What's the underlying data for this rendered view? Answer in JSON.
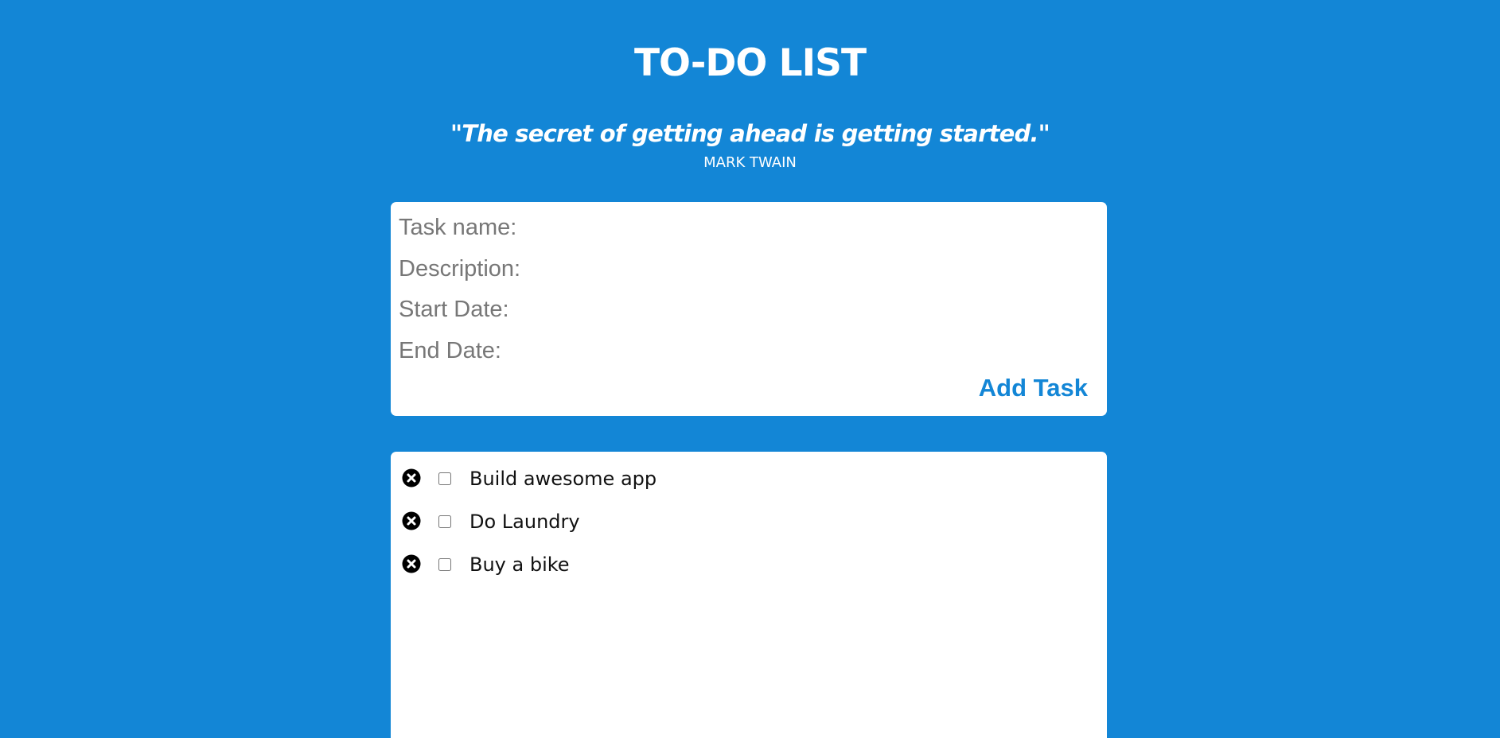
{
  "header": {
    "title": "TO-DO LIST",
    "quote": "\"The secret of getting ahead is getting started.\"",
    "author": "MARK TWAIN"
  },
  "form": {
    "task_name_placeholder": "Task name:",
    "description_placeholder": "Description:",
    "start_date_placeholder": "Start Date:",
    "end_date_placeholder": "End Date:",
    "add_button_label": "Add Task"
  },
  "tasks": [
    {
      "label": "Build awesome app",
      "checked": false,
      "delete_icon": "close-circle-icon"
    },
    {
      "label": "Do Laundry",
      "checked": false,
      "delete_icon": "close-circle-icon"
    },
    {
      "label": "Buy a bike",
      "checked": false,
      "delete_icon": "close-circle-icon"
    }
  ],
  "colors": {
    "background": "#1386d6",
    "card": "#ffffff",
    "accent": "#1386d6",
    "placeholder": "#777777"
  }
}
